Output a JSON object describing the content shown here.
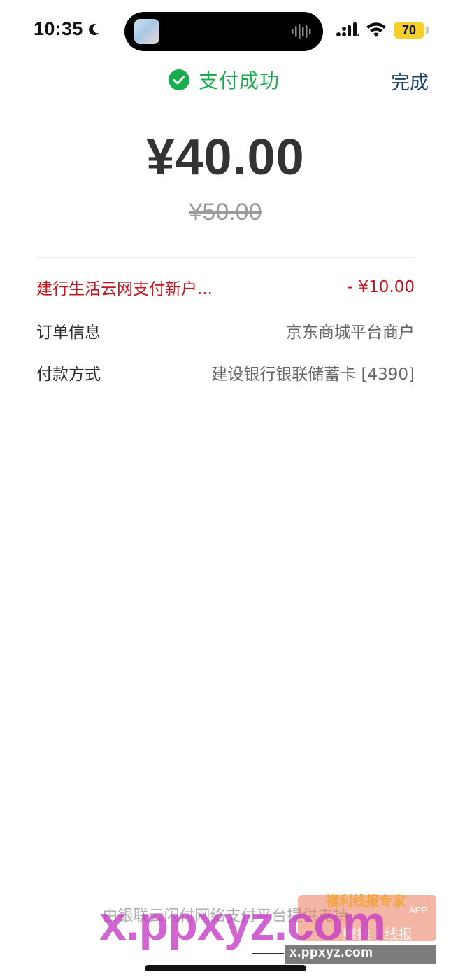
{
  "status_bar": {
    "time": "10:35",
    "battery": "70",
    "icons": [
      "moon-icon",
      "signal-icon",
      "wifi-icon",
      "battery-icon"
    ],
    "colors": {
      "battery": "#f4d02a"
    }
  },
  "header": {
    "title": "支付成功",
    "done_label": "完成",
    "colors": {
      "success": "#1aad4e",
      "done": "#1f3f6e"
    }
  },
  "payment": {
    "amount": "¥40.00",
    "original_amount": "¥50.00"
  },
  "details": {
    "discount": {
      "label": "建行生活云网支付新户...",
      "value": "- ¥10.00",
      "color": "#c4151c"
    },
    "order": {
      "label": "订单信息",
      "value": "京东商城平台商户"
    },
    "method": {
      "label": "付款方式",
      "value": "建设银行银联储蓄卡 [4390]"
    }
  },
  "footer": {
    "text": "由银联云闪付网络支付平台提供支持"
  },
  "watermark": {
    "big": "x.ppxyz.com",
    "badge_title": "福利线报专家",
    "badge_app": "APP",
    "badge_sub": "赚钱 | 线报",
    "url": "x.ppxyz.com"
  }
}
